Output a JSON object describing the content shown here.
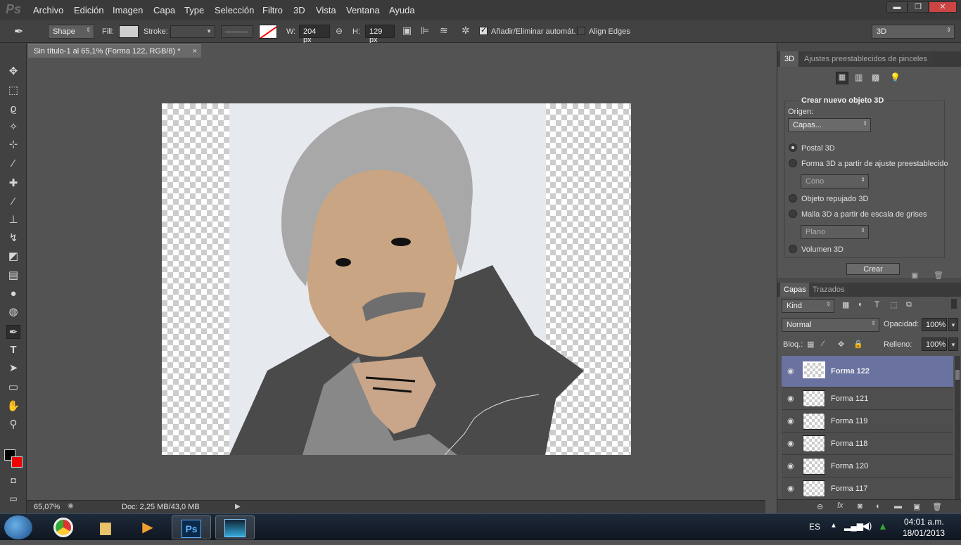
{
  "menu": {
    "logo": "Ps",
    "items": [
      "Archivo",
      "Edición",
      "Imagen",
      "Capa",
      "Type",
      "Selección",
      "Filtro",
      "3D",
      "Vista",
      "Ventana",
      "Ayuda"
    ]
  },
  "window_controls": {
    "minimize": "▬",
    "restore": "❐",
    "close": "✕"
  },
  "options": {
    "mode": "Shape",
    "fill_label": "Fill:",
    "stroke_label": "Stroke:",
    "w_label": "W:",
    "w_value": "204 px",
    "h_label": "H:",
    "h_value": "129 px",
    "auto_add_delete": "Añadir/Eliminar automát.",
    "align_edges": "Align Edges",
    "workspace": "3D",
    "fill_color": "#cfcfcf",
    "stroke_color": "#ff0000"
  },
  "document": {
    "tab_title": "Sin título-1 al 65,1% (Forma 122, RGB/8) *",
    "close": "×",
    "zoom": "65,07%",
    "doc_info": "Doc: 2,25 MB/43,0 MB"
  },
  "tools": [
    "move-icon",
    "marquee-icon",
    "lasso-icon",
    "magic-wand-icon",
    "crop-icon",
    "eyedropper-icon",
    "healing-icon",
    "brush-icon",
    "stamp-icon",
    "history-brush-icon",
    "eraser-icon",
    "gradient-icon",
    "blur-icon",
    "dodge-icon",
    "pen-icon",
    "type-icon",
    "path-select-icon",
    "shape-icon",
    "hand-icon",
    "zoom-icon"
  ],
  "panel3d": {
    "tabs": [
      "3D",
      "Ajustes preestablecidos de pinceles"
    ],
    "section_title": "Crear nuevo objeto 3D",
    "origin_label": "Origen:",
    "origin_value": "Capas...",
    "options": [
      {
        "label": "Postal 3D",
        "selected": true
      },
      {
        "label": "Forma 3D a partir de ajuste preestablecido",
        "selected": false
      },
      {
        "label": "Objeto repujado 3D",
        "selected": false
      },
      {
        "label": "Malla 3D a partir de escala de grises",
        "selected": false
      },
      {
        "label": "Volumen 3D",
        "selected": false
      }
    ],
    "preset_shape": "Cono",
    "preset_plane": "Plano",
    "create_button": "Crear"
  },
  "layers": {
    "tabs": [
      "Capas",
      "Trazados"
    ],
    "filter_kind": "Kind",
    "blend_mode": "Normal",
    "opacity_label": "Opacidad:",
    "opacity_value": "100%",
    "lock_label": "Bloq.:",
    "fill_label": "Relleno:",
    "fill_value": "100%",
    "items": [
      {
        "name": "Forma 122",
        "selected": true
      },
      {
        "name": "Forma 121",
        "selected": false
      },
      {
        "name": "Forma 119",
        "selected": false
      },
      {
        "name": "Forma 118",
        "selected": false
      },
      {
        "name": "Forma 120",
        "selected": false
      },
      {
        "name": "Forma 117",
        "selected": false
      }
    ]
  },
  "taskbar": {
    "language": "ES",
    "time": "04:01 a.m.",
    "date": "18/01/2013",
    "apps": [
      "windows-start-icon",
      "chrome-icon",
      "explorer-icon",
      "media-player-icon",
      "photoshop-icon",
      "app-icon"
    ],
    "ps_label": "Ps"
  }
}
